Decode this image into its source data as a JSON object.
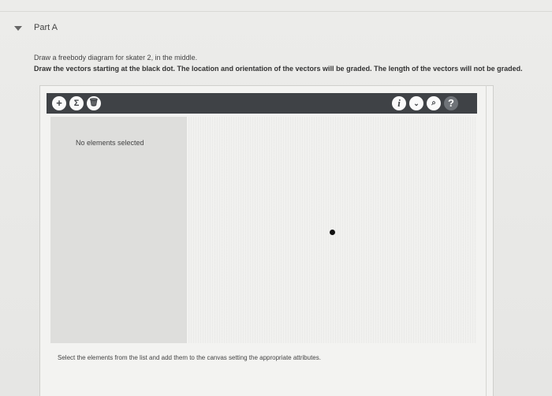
{
  "part": {
    "title": "Part A"
  },
  "instructions": {
    "line1": "Draw a freebody diagram for skater 2, in the middle.",
    "line2": "Draw the vectors starting at the black dot. The location and orientation of the vectors will be graded. The length of the vectors will not be graded."
  },
  "toolbar": {
    "add_icon": "+",
    "sum_icon": "Σ",
    "delete_icon": "🗑",
    "info_icon": "i",
    "dropdown_icon": "⌄",
    "search_icon": "⌕",
    "help_icon": "?"
  },
  "panel": {
    "empty_message": "No elements selected"
  },
  "hint": "Select the elements from the list and add them to the canvas setting the appropriate attributes.",
  "colors": {
    "toolbar_bg": "#3f4246",
    "dot": "#111111"
  }
}
